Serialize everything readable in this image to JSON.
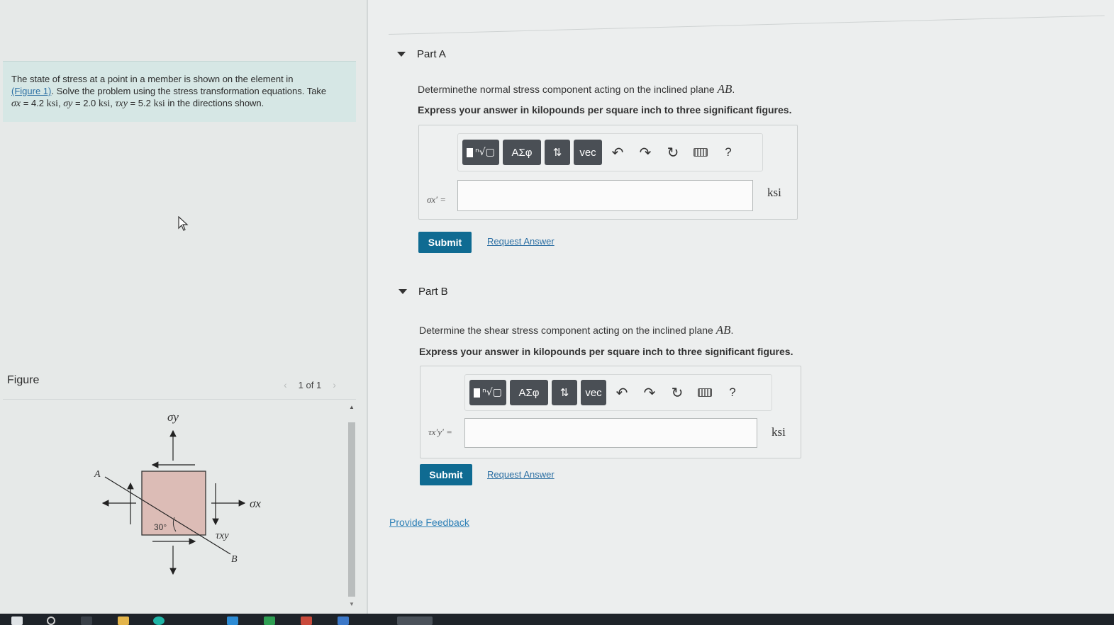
{
  "problem": {
    "intro": "The state of stress at a point in a member is shown on the element in",
    "figure_link": "(Figure 1)",
    "instructions": ". Solve the problem using the stress transformation equations. Take",
    "sx_sym": "σx",
    "sx_val": "= 4.2",
    "sy_sym": "σy",
    "sy_val": "= 2.0",
    "txy_sym": "τxy",
    "txy_val": "= 5.2",
    "ksi": "ksi",
    "tail": "in the directions shown."
  },
  "figure": {
    "label": "Figure",
    "pager": "1 of 1",
    "prev": "‹",
    "next": "›",
    "sigma_y": "σy",
    "sigma_x": "σx",
    "tau_xy": "τxy",
    "angle": "30°",
    "point_a": "A",
    "point_b": "B"
  },
  "part_a": {
    "title": "Part A",
    "question": "Determinethe normal stress component acting on the inclined plane",
    "plane": "AB",
    "instruction": "Express your answer in kilopounds per square inch to three significant figures.",
    "variable": "σx′ =",
    "unit": "ksi",
    "submit": "Submit",
    "request": "Request Answer"
  },
  "part_b": {
    "title": "Part B",
    "question": "Determine the shear stress component acting on the inclined plane",
    "plane": "AB",
    "instruction": "Express your answer in kilopounds per square inch to three significant figures.",
    "variable": "τx′y′ =",
    "unit": "ksi",
    "submit": "Submit",
    "request": "Request Answer"
  },
  "toolbar": {
    "greek": "ΑΣφ",
    "arrows": "⇅",
    "vec": "vec",
    "help": "?"
  },
  "feedback": "Provide Feedback",
  "colors": {
    "submit": "#0f6b92",
    "link": "#2c6fa3",
    "problem_bg": "#d6e7e5",
    "tool_btn": "#4a4f55"
  }
}
